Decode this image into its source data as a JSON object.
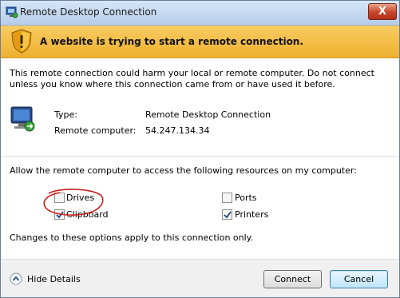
{
  "window": {
    "title": "Remote Desktop Connection",
    "close_glyph": "X"
  },
  "warning": {
    "text": "A website is trying to start a remote connection."
  },
  "body": {
    "message": "This remote connection could harm your local or remote computer. Do not connect unless you know where this connection came from or have used it before."
  },
  "details": {
    "type_label": "Type:",
    "type_value": "Remote Desktop Connection",
    "remote_label": "Remote computer:",
    "remote_value": "54.247.134.34"
  },
  "resources": {
    "prompt": "Allow the remote computer to access the following resources on my computer:",
    "items": [
      {
        "label": "Drives",
        "checked": false
      },
      {
        "label": "Clipboard",
        "checked": true
      },
      {
        "label": "Ports",
        "checked": false
      },
      {
        "label": "Printers",
        "checked": true
      }
    ],
    "note": "Changes to these options apply to this connection only."
  },
  "footer": {
    "hide_details": "Hide Details",
    "connect": "Connect",
    "cancel": "Cancel"
  },
  "colors": {
    "warning_band": "#f0b43a",
    "annotation_circle": "#cc1f1f"
  },
  "icons": {
    "app": "remote-desktop-icon",
    "shield": "warning-shield-icon",
    "computer": "computer-monitor-icon",
    "collapse": "chevron-up-icon"
  }
}
